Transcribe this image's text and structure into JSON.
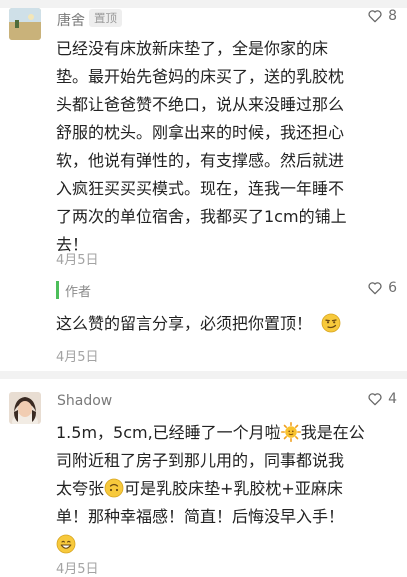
{
  "comment1": {
    "username": "唐舍",
    "badge": "置顶",
    "likes": "8",
    "text_lines": [
      "已经没有床放新床垫了，全是你家的床",
      "垫。最开始先爸妈的床买了，送的乳胶枕",
      "头都让爸爸赞不绝口，说从来没睡过那么",
      "舒服的枕头。刚拿出来的时候，我还担心",
      "软，他说有弹性的，有支撑感。然后就进",
      "入疯狂买买买模式。现在，连我一年睡不",
      "了两次的单位宿舍，我都买了1cm的铺上",
      "去！"
    ],
    "date": "4月5日"
  },
  "reply1": {
    "label": "作者",
    "likes": "6",
    "text": "这么赞的留言分享，必须把你置顶！",
    "date": "4月5日"
  },
  "comment2": {
    "username": "Shadow",
    "likes": "4",
    "lines": [
      [
        "1.5m，5cm,已经睡了一个月啦",
        "我是在公"
      ],
      [
        "司附近租了房子到那儿用的，同事都说我"
      ],
      [
        "太夸张",
        "可是乳胶床垫+乳胶枕+亚麻床"
      ],
      [
        "单！那种幸福感！简直！后悔没早入手！"
      ]
    ],
    "date": "4月5日"
  },
  "colors": {
    "accent_green": "#4cbe5a",
    "text": "#222222",
    "muted": "#a3a3a3",
    "separator": "#f2f2f2"
  },
  "icons": {
    "like": "heart-outline-icon",
    "reply_emoji": "smirk-emoji",
    "sun_emoji": "sun-emoji",
    "upside_emoji": "upside-down-face-emoji",
    "grin_emoji": "grin-emoji"
  }
}
